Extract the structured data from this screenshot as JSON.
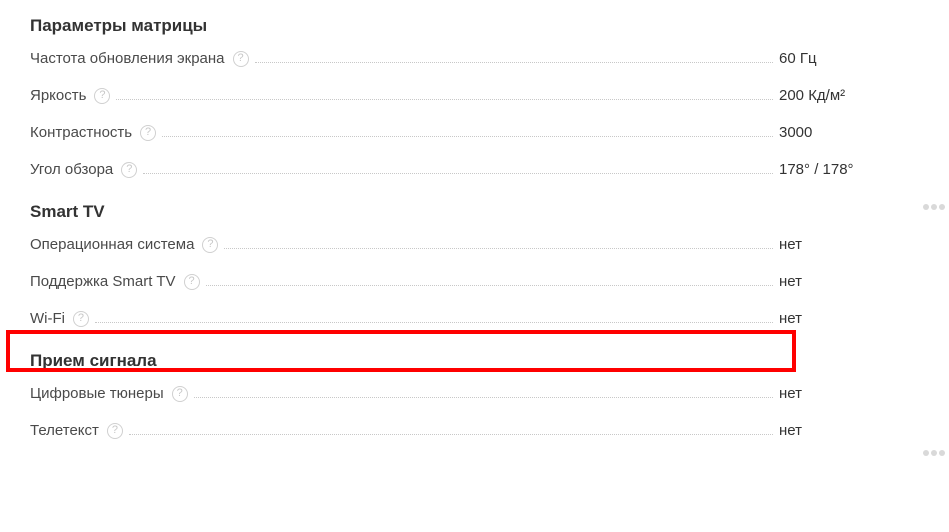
{
  "sections": [
    {
      "title": "Параметры матрицы",
      "rows": [
        {
          "label": "Частота обновления экрана",
          "value": "60 Гц"
        },
        {
          "label": "Яркость",
          "value": "200 Кд/м²"
        },
        {
          "label": "Контрастность",
          "value": "3000"
        },
        {
          "label": "Угол обзора",
          "value": "178° / 178°"
        }
      ]
    },
    {
      "title": "Smart TV",
      "rows": [
        {
          "label": "Операционная система",
          "value": "нет"
        },
        {
          "label": "Поддержка Smart TV",
          "value": "нет"
        },
        {
          "label": "Wi-Fi",
          "value": "нет"
        }
      ]
    },
    {
      "title": "Прием сигнала",
      "rows": [
        {
          "label": "Цифровые тюнеры",
          "value": "нет"
        },
        {
          "label": "Телетекст",
          "value": "нет"
        }
      ]
    }
  ],
  "help_glyph": "?"
}
